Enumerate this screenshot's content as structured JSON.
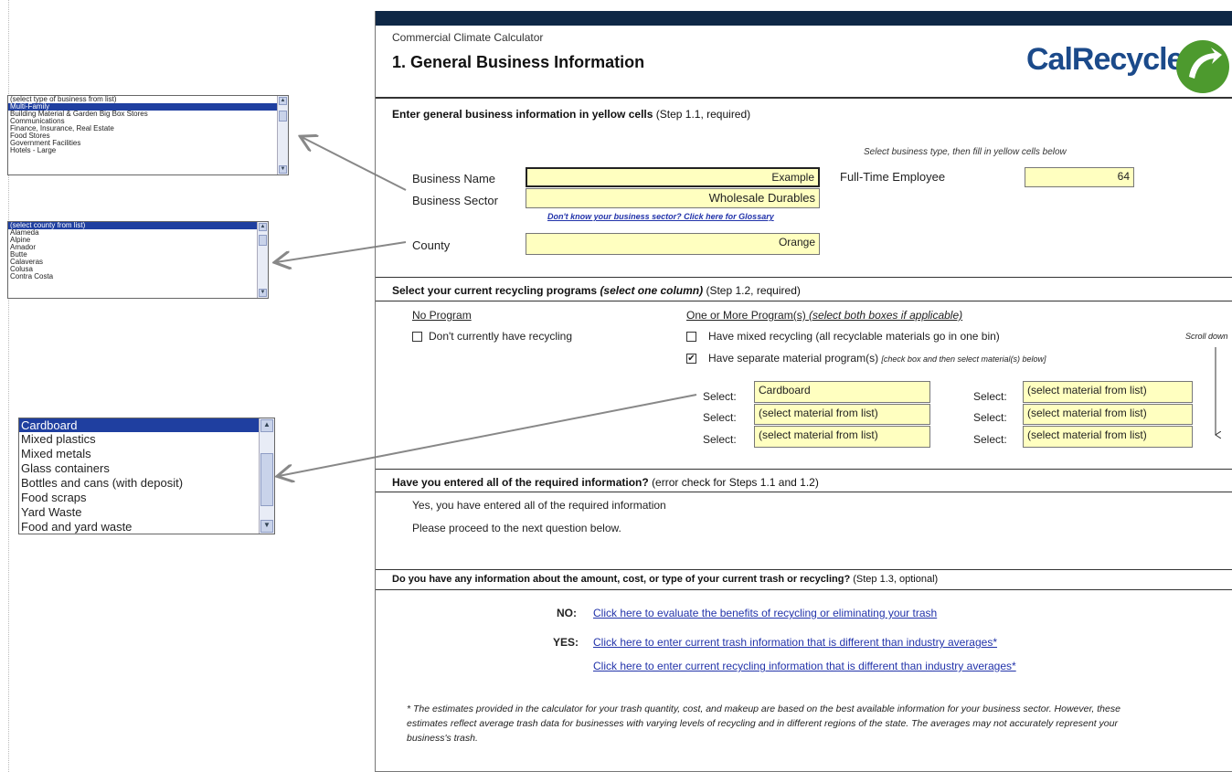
{
  "header": {
    "app_title": "Commercial Climate Calculator",
    "section_title": "1. General Business Information",
    "logo_text": "CalRecycle"
  },
  "step11": {
    "heading": "Enter general business information in yellow cells",
    "heading_suffix": "(Step 1.1, required)",
    "hint": "Select business type, then fill in yellow cells below",
    "business_name_label": "Business Name",
    "business_name_value": "Example",
    "business_sector_label": "Business Sector",
    "business_sector_value": "Wholesale Durables",
    "glossary_link": "Don't know your business sector? Click here for Glossary",
    "county_label": "County",
    "county_value": "Orange",
    "employee_label": "Full-Time Employee",
    "employee_value": "64"
  },
  "step12": {
    "heading": "Select your current recycling programs",
    "heading_italic": "(select one column)",
    "heading_suffix": "(Step 1.2, required)",
    "no_program_label": "No Program",
    "no_recycling_label": "Don't currently have recycling",
    "one_or_more_label": "One or More Program(s)",
    "one_or_more_hint": "(select both boxes if applicable)",
    "mixed_label": "Have mixed recycling (all recyclable materials go in one bin)",
    "separate_label": "Have separate material program(s)",
    "separate_hint": "[check box and then select material(s) below]",
    "scroll_hint": "Scroll down",
    "select_label": "Select:",
    "left_selects": [
      "Cardboard",
      "(select material from list)",
      "(select material from list)"
    ],
    "right_selects": [
      "(select material from list)",
      "(select material from list)",
      "(select material from list)"
    ]
  },
  "check": {
    "heading": "Have you entered all of the required information?",
    "heading_suffix": "(error check for Steps 1.1 and 1.2)",
    "msg1": "Yes, you have entered all of the required information",
    "msg2": "Please proceed to the next question below."
  },
  "step13": {
    "heading": "Do you have any information about the amount, cost, or type of your current trash or recycling?",
    "heading_suffix": "(Step 1.3, optional)",
    "no_label": "NO:",
    "no_link": "Click here to evaluate the benefits of recycling or eliminating your trash",
    "yes_label": "YES:",
    "yes_link1": "Click here to enter current trash information that is different than industry averages*",
    "yes_link2": "Click here to enter current recycling information that is different than industry averages*",
    "footnote": "* The estimates provided in the calculator for your trash quantity, cost, and makeup are based on the best available information for your business sector.  However, these estimates reflect average trash data for businesses with varying levels of recycling and in different regions of the state.  The averages may not accurately represent your business's trash."
  },
  "dropdowns": {
    "business_type": [
      "(select type of business from list)",
      "Multi-Family",
      "Building Material & Garden Big Box Stores",
      "Communications",
      "Finance, Insurance, Real Estate",
      "Food Stores",
      "Government Facilities",
      "Hotels - Large"
    ],
    "county": [
      "(select county from list)",
      "Alameda",
      "Alpine",
      "Amador",
      "Butte",
      "Calaveras",
      "Colusa",
      "Contra Costa"
    ],
    "material": [
      "Cardboard",
      "Mixed plastics",
      "Mixed metals",
      "Glass containers",
      "Bottles and cans (with deposit)",
      "Food scraps",
      "Yard Waste",
      "Food and yard waste"
    ]
  },
  "colors": {
    "topbar": "#0f2846",
    "yellow_cell": "#ffffc0",
    "link": "#2233aa",
    "logo_blue": "#1b4a8a",
    "logo_green": "#4d9a2e",
    "list_selected": "#1f3fa0"
  }
}
